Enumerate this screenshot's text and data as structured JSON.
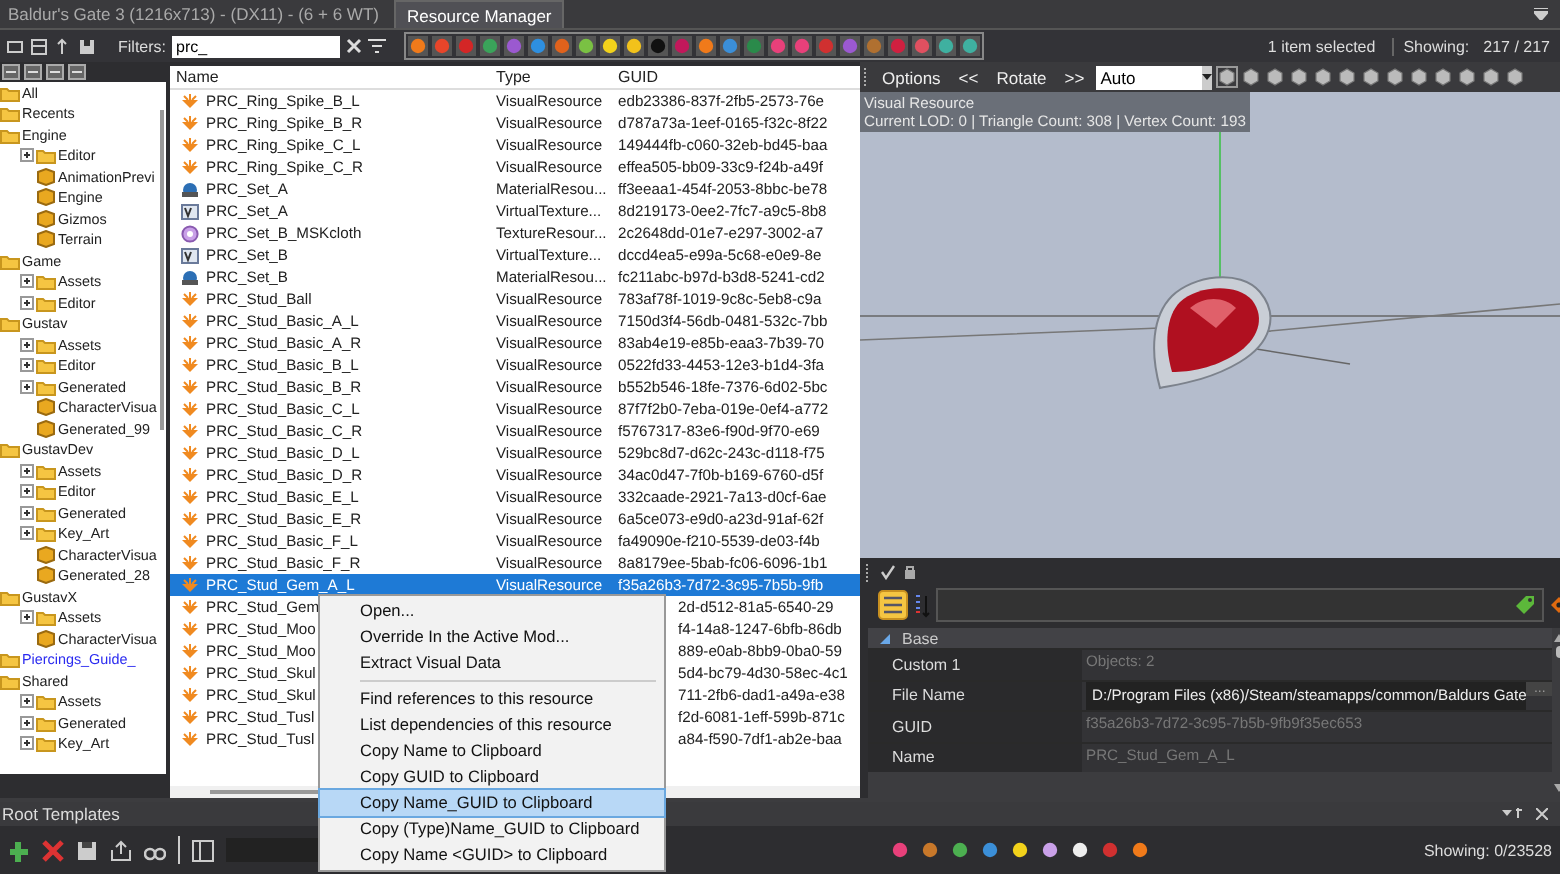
{
  "window": {
    "title": "Baldur's Gate 3 (1216x713) - (DX11) - (6 + 6 WT)"
  },
  "tabs": [
    {
      "label": "Resource Manager",
      "selected": true
    }
  ],
  "toolbar": {
    "filter_label": "Filters:",
    "filter_value": "prc_",
    "selection_status": "1 item selected",
    "showing_label": "Showing:",
    "showing_value": "217 / 217"
  },
  "tree": [
    {
      "label": "All",
      "kind": "folder"
    },
    {
      "label": "Recents",
      "kind": "folder"
    },
    {
      "label": "Engine",
      "kind": "folder",
      "children": [
        {
          "label": "Editor",
          "kind": "folder",
          "expanded": false
        },
        {
          "label": "AnimationPrevi",
          "kind": "package"
        },
        {
          "label": "Engine",
          "kind": "package"
        },
        {
          "label": "Gizmos",
          "kind": "package"
        },
        {
          "label": "Terrain",
          "kind": "package"
        }
      ]
    },
    {
      "label": "Game",
      "kind": "folder",
      "children": [
        {
          "label": "Assets",
          "kind": "folder",
          "expanded": false
        },
        {
          "label": "Editor",
          "kind": "folder",
          "expanded": false
        }
      ]
    },
    {
      "label": "Gustav",
      "kind": "folder",
      "children": [
        {
          "label": "Assets",
          "kind": "folder",
          "expanded": false
        },
        {
          "label": "Editor",
          "kind": "folder",
          "expanded": false
        },
        {
          "label": "Generated",
          "kind": "folder",
          "expanded": false
        },
        {
          "label": "CharacterVisua",
          "kind": "package"
        },
        {
          "label": "Generated_99",
          "kind": "package"
        }
      ]
    },
    {
      "label": "GustavDev",
      "kind": "folder",
      "children": [
        {
          "label": "Assets",
          "kind": "folder",
          "expanded": false
        },
        {
          "label": "Editor",
          "kind": "folder",
          "expanded": false
        },
        {
          "label": "Generated",
          "kind": "folder",
          "expanded": false
        },
        {
          "label": "Key_Art",
          "kind": "folder",
          "expanded": false
        },
        {
          "label": "CharacterVisua",
          "kind": "package"
        },
        {
          "label": "Generated_28",
          "kind": "package"
        }
      ]
    },
    {
      "label": "GustavX",
      "kind": "folder",
      "children": [
        {
          "label": "Assets",
          "kind": "folder",
          "expanded": false
        },
        {
          "label": "CharacterVisua",
          "kind": "package"
        }
      ]
    },
    {
      "label": "Piercings_Guide_",
      "kind": "mod"
    },
    {
      "label": "Shared",
      "kind": "folder",
      "children": [
        {
          "label": "Assets",
          "kind": "folder",
          "expanded": false
        },
        {
          "label": "Generated",
          "kind": "folder",
          "expanded": false
        },
        {
          "label": "Key_Art",
          "kind": "folder",
          "expanded": false
        }
      ]
    }
  ],
  "table": {
    "columns": [
      "Name",
      "Type",
      "GUID"
    ],
    "rows": [
      {
        "name": "PRC_Ring_Spike_B_L",
        "kind": "visual",
        "type": "VisualResource",
        "guid": "edb23386-837f-2fb5-2573-76e",
        "selected": false
      },
      {
        "name": "PRC_Ring_Spike_B_R",
        "kind": "visual",
        "type": "VisualResource",
        "guid": "d787a73a-1eef-0165-f32c-8f22",
        "selected": false
      },
      {
        "name": "PRC_Ring_Spike_C_L",
        "kind": "visual",
        "type": "VisualResource",
        "guid": "149444fb-c060-32eb-bd45-baa",
        "selected": false
      },
      {
        "name": "PRC_Ring_Spike_C_R",
        "kind": "visual",
        "type": "VisualResource",
        "guid": "effea505-bb09-33c9-f24b-a49f",
        "selected": false
      },
      {
        "name": "PRC_Set_A",
        "kind": "material",
        "type": "MaterialResou...",
        "guid": "ff3eeaa1-454f-2053-8bbc-be78",
        "selected": false
      },
      {
        "name": "PRC_Set_A",
        "kind": "virtual-texture",
        "type": "VirtualTexture...",
        "guid": "8d219173-0ee2-7fc7-a9c5-8b8",
        "selected": false
      },
      {
        "name": "PRC_Set_B_MSKcloth",
        "kind": "texture",
        "type": "TextureResour...",
        "guid": "2c2648dd-01e7-e297-3002-a7",
        "selected": false
      },
      {
        "name": "PRC_Set_B",
        "kind": "virtual-texture",
        "type": "VirtualTexture...",
        "guid": "dccd4ea5-e99a-5c68-e0e9-8e",
        "selected": false
      },
      {
        "name": "PRC_Set_B",
        "kind": "material",
        "type": "MaterialResou...",
        "guid": "fc211abc-b97d-b3d8-5241-cd2",
        "selected": false
      },
      {
        "name": "PRC_Stud_Ball",
        "kind": "visual",
        "type": "VisualResource",
        "guid": "783af78f-1019-9c8c-5eb8-c9a",
        "selected": false
      },
      {
        "name": "PRC_Stud_Basic_A_L",
        "kind": "visual",
        "type": "VisualResource",
        "guid": "7150d3f4-56db-0481-532c-7bb",
        "selected": false
      },
      {
        "name": "PRC_Stud_Basic_A_R",
        "kind": "visual",
        "type": "VisualResource",
        "guid": "83ab4e19-e85b-eaa3-7b39-70",
        "selected": false
      },
      {
        "name": "PRC_Stud_Basic_B_L",
        "kind": "visual",
        "type": "VisualResource",
        "guid": "0522fd33-4453-12e3-b1d4-3fa",
        "selected": false
      },
      {
        "name": "PRC_Stud_Basic_B_R",
        "kind": "visual",
        "type": "VisualResource",
        "guid": "b552b546-18fe-7376-6d02-5bc",
        "selected": false
      },
      {
        "name": "PRC_Stud_Basic_C_L",
        "kind": "visual",
        "type": "VisualResource",
        "guid": "87f7f2b0-7eba-019e-0ef4-a772",
        "selected": false
      },
      {
        "name": "PRC_Stud_Basic_C_R",
        "kind": "visual",
        "type": "VisualResource",
        "guid": "f5767317-83e6-f90d-9f70-e69",
        "selected": false
      },
      {
        "name": "PRC_Stud_Basic_D_L",
        "kind": "visual",
        "type": "VisualResource",
        "guid": "529bc8d7-d62c-243c-d118-f75",
        "selected": false
      },
      {
        "name": "PRC_Stud_Basic_D_R",
        "kind": "visual",
        "type": "VisualResource",
        "guid": "34ac0d47-7f0b-b169-6760-d5f",
        "selected": false
      },
      {
        "name": "PRC_Stud_Basic_E_L",
        "kind": "visual",
        "type": "VisualResource",
        "guid": "332caade-2921-7a13-d0cf-6ae",
        "selected": false
      },
      {
        "name": "PRC_Stud_Basic_E_R",
        "kind": "visual",
        "type": "VisualResource",
        "guid": "6a5ce073-e9d0-a23d-91af-62f",
        "selected": false
      },
      {
        "name": "PRC_Stud_Basic_F_L",
        "kind": "visual",
        "type": "VisualResource",
        "guid": "fa49090e-f210-5539-de03-f4b",
        "selected": false
      },
      {
        "name": "PRC_Stud_Basic_F_R",
        "kind": "visual",
        "type": "VisualResource",
        "guid": "8a8179ee-5bab-fc06-6096-1b1",
        "selected": false
      },
      {
        "name": "PRC_Stud_Gem_A_L",
        "kind": "visual",
        "type": "VisualResource",
        "guid": "f35a26b3-7d72-3c95-7b5b-9fb",
        "selected": true
      },
      {
        "name": "PRC_Stud_Gem",
        "kind": "visual",
        "guid": "2d-d512-81a5-6540-29",
        "selected": false
      },
      {
        "name": "PRC_Stud_Moo",
        "kind": "visual",
        "guid": "f4-14a8-1247-6bfb-86db",
        "selected": false
      },
      {
        "name": "PRC_Stud_Moo",
        "kind": "visual",
        "guid": "889-e0ab-8bb9-0ba0-59",
        "selected": false
      },
      {
        "name": "PRC_Stud_Skul",
        "kind": "visual",
        "guid": "5d4-bc79-4d30-58ec-4c1",
        "selected": false
      },
      {
        "name": "PRC_Stud_Skul",
        "kind": "visual",
        "guid": "711-2fb6-dad1-a49a-e38",
        "selected": false
      },
      {
        "name": "PRC_Stud_Tusl",
        "kind": "visual",
        "guid": "f2d-6081-1eff-599b-871c",
        "selected": false
      },
      {
        "name": "PRC_Stud_Tusl",
        "kind": "visual",
        "guid": "a84-f590-7df1-ab2e-baa",
        "selected": false
      }
    ]
  },
  "context_menu": {
    "items": [
      {
        "label": "Open...",
        "highlighted": false,
        "separator_before": false
      },
      {
        "label": "Override In the Active Mod...",
        "highlighted": false,
        "separator_before": false
      },
      {
        "label": "Extract Visual Data",
        "highlighted": false,
        "separator_before": false
      },
      {
        "label": "Find references to this resource",
        "highlighted": false,
        "separator_before": true
      },
      {
        "label": "List dependencies of this resource",
        "highlighted": false,
        "separator_before": false
      },
      {
        "label": "Copy Name to Clipboard",
        "highlighted": false,
        "separator_before": false
      },
      {
        "label": "Copy GUID to Clipboard",
        "highlighted": false,
        "separator_before": false
      },
      {
        "label": "Copy Name_GUID to Clipboard",
        "highlighted": true,
        "separator_before": false
      },
      {
        "label": "Copy (Type)Name_GUID to Clipboard",
        "highlighted": false,
        "separator_before": false
      },
      {
        "label": "Copy Name <GUID> to Clipboard",
        "highlighted": false,
        "separator_before": false
      }
    ]
  },
  "preview": {
    "options": "Options",
    "prev": "<<",
    "rotate": "Rotate",
    "next": ">>",
    "mode": "Auto",
    "resource_type": "Visual Resource",
    "stats": "Current LOD: 0  |  Triangle Count: 308  |  Vertex Count: 193"
  },
  "properties": {
    "group": "Base",
    "expanded": true,
    "rows": [
      {
        "label": "Custom 1",
        "value": "Objects: 2",
        "editable": false
      },
      {
        "label": "File Name",
        "value": "D:/Program Files (x86)/Steam/steamapps/common/Baldurs Gate",
        "editable": true,
        "button": "..."
      },
      {
        "label": "GUID",
        "value": "f35a26b3-7d72-3c95-7b5b-9fb9f35ec653",
        "editable": false
      },
      {
        "label": "Name",
        "value": "PRC_Stud_Gem_A_L",
        "editable": false
      }
    ]
  },
  "bottom_panel": {
    "title": "Root Templates",
    "showing": "Showing: 0/23528"
  }
}
